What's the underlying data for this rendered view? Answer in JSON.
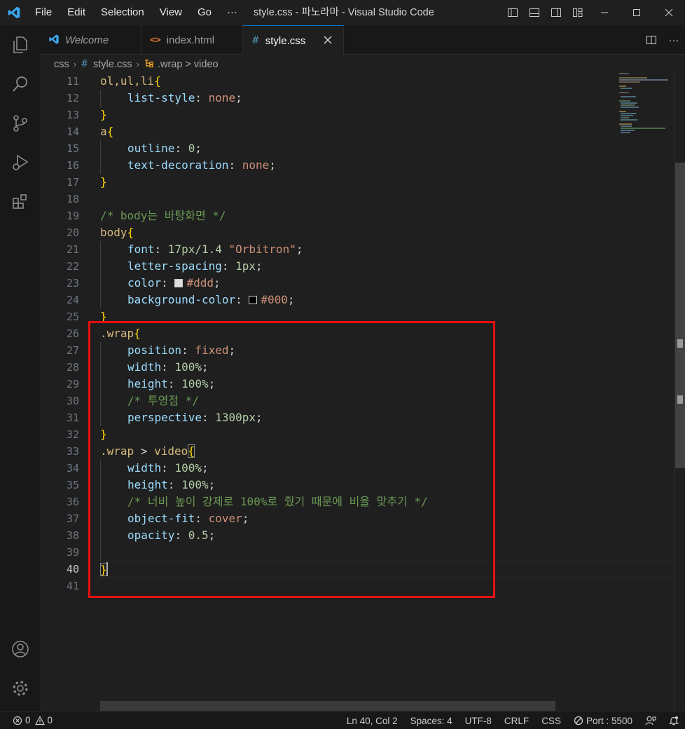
{
  "titlebar": {
    "menu": [
      "File",
      "Edit",
      "Selection",
      "View",
      "Go",
      "···"
    ],
    "title": "style.css - 파노라마 - Visual Studio Code"
  },
  "tabs": [
    {
      "label": "Welcome",
      "icon": "vscode-icon",
      "italic": true
    },
    {
      "label": "index.html",
      "icon": "html-icon"
    },
    {
      "label": "style.css",
      "icon": "css-icon",
      "active": true
    }
  ],
  "breadcrumb": {
    "folder": "css",
    "file": "style.css",
    "symbol": ".wrap > video"
  },
  "editor": {
    "current_line": 40,
    "line_numbers": [
      "11",
      "12",
      "13",
      "14",
      "15",
      "16",
      "17",
      "18",
      "19",
      "20",
      "21",
      "22",
      "23",
      "24",
      "25",
      "26",
      "27",
      "28",
      "29",
      "30",
      "31",
      "32",
      "33",
      "34",
      "35",
      "36",
      "37",
      "38",
      "39",
      "40",
      "41"
    ],
    "lines": {
      "l11_sel": "ol,ul,li",
      "l12_prop": "list-style",
      "l12_val": "none",
      "l14_sel": "a",
      "l15_prop": "outline",
      "l15_val": "0",
      "l16_prop": "text-decoration",
      "l16_val": "none",
      "l19_cmt": "/* body는 바탕화면 */",
      "l20_sel": "body",
      "l21_prop": "font",
      "l21_num": "17px/1.4",
      "l21_str": "\"Orbitron\"",
      "l22_prop": "letter-spacing",
      "l22_num": "1px",
      "l23_prop": "color",
      "l23_val": "#ddd",
      "l24_prop": "background-color",
      "l24_val": "#000",
      "l26_sel": ".wrap",
      "l27_prop": "position",
      "l27_val": "fixed",
      "l28_prop": "width",
      "l28_num": "100%",
      "l29_prop": "height",
      "l29_num": "100%",
      "l30_cmt": "/* 투영점 */",
      "l31_prop": "perspective",
      "l31_num": "1300px",
      "l33_sel_a": ".wrap",
      "l33_sel_b": "video",
      "l34_prop": "width",
      "l34_num": "100%",
      "l35_prop": "height",
      "l35_num": "100%",
      "l36_cmt": "/* 너비 높이 강제로 100%로 줬기 때문에 비율 맞추기 */",
      "l37_prop": "object-fit",
      "l37_val": "cover",
      "l38_prop": "opacity",
      "l38_num": "0.5"
    },
    "swatch_colors": {
      "ddd": "#dddddd",
      "black": "#000000"
    }
  },
  "statusbar": {
    "errors": "0",
    "warnings": "0",
    "position": "Ln 40, Col 2",
    "spaces": "Spaces: 4",
    "encoding": "UTF-8",
    "eol": "CRLF",
    "language": "CSS",
    "port": "Port : 5500"
  },
  "colors": {
    "accent": "#0078d4",
    "highlight_box": "#e81010"
  }
}
